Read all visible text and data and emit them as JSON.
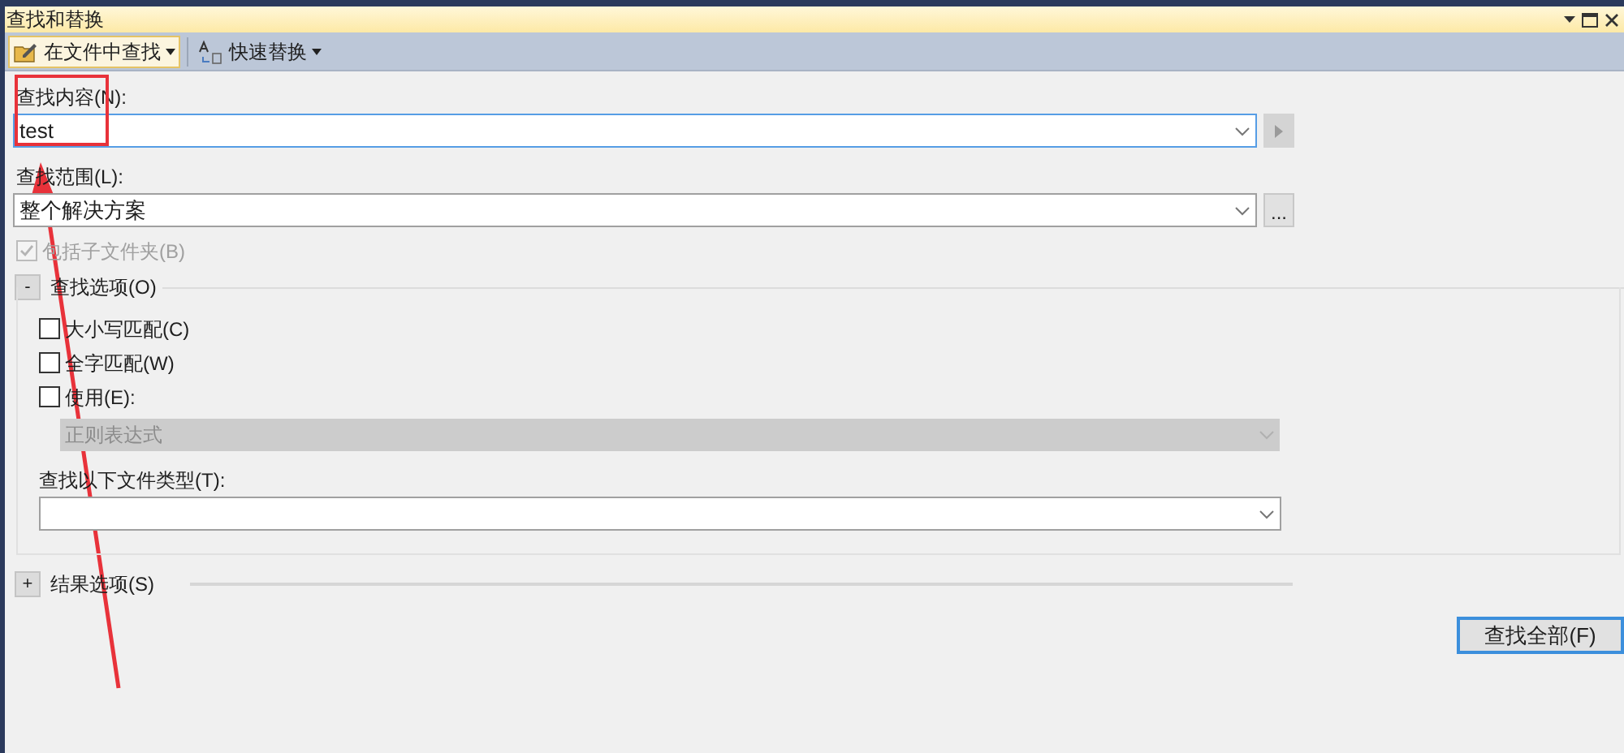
{
  "window": {
    "title": "查找和替换"
  },
  "toolbar": [
    {
      "label": "在文件中查找",
      "kind": "split",
      "selected": true
    },
    {
      "label": "快速替换",
      "kind": "menu",
      "selected": false
    }
  ],
  "find_what": {
    "label": "查找内容(N):",
    "value": "test"
  },
  "look_in": {
    "label": "查找范围(L):",
    "value": "整个解决方案",
    "browse": "..."
  },
  "include_subfolders": {
    "label": "包括子文件夹(B)",
    "checked": true,
    "disabled": true
  },
  "find_options": {
    "title": "查找选项(O)",
    "toggle": "-",
    "expanded": true,
    "checkboxes": [
      {
        "label": "大小写匹配(C)",
        "checked": false
      },
      {
        "label": "全字匹配(W)",
        "checked": false
      },
      {
        "label": "使用(E):",
        "checked": false
      }
    ],
    "regex_combo": {
      "value": "正则表达式",
      "disabled": true
    },
    "file_types": {
      "label": "查找以下文件类型(T):"
    }
  },
  "result_options": {
    "title": "结果选项(S)",
    "toggle": "+"
  },
  "buttons": [
    {
      "label": "查找全部(F)"
    }
  ]
}
